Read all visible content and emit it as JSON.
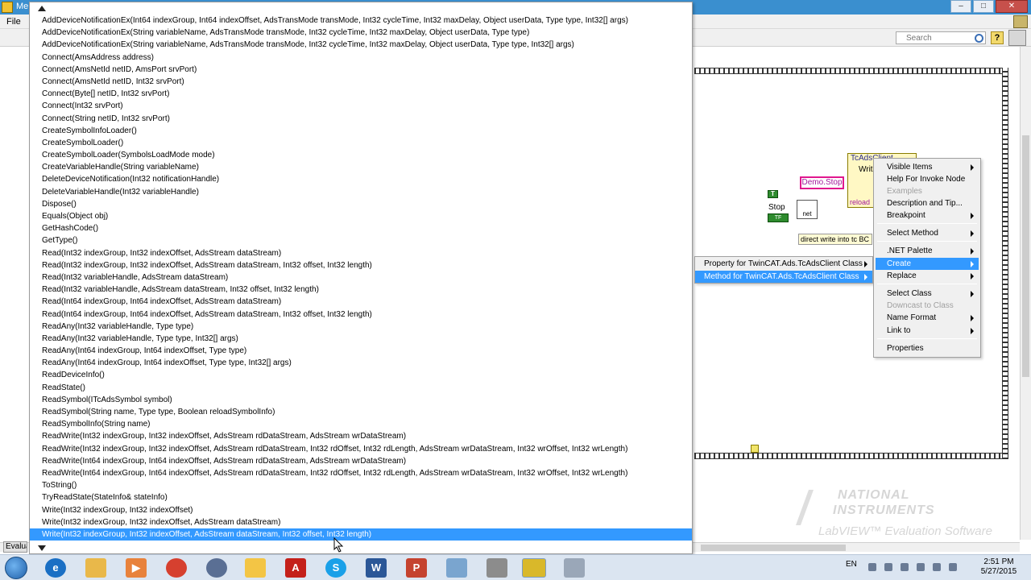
{
  "window": {
    "title_fragment": "Mel",
    "menu_file": "File",
    "search_placeholder": "Search",
    "eval_label": "Evaluat"
  },
  "methods": {
    "items": [
      "AddDeviceNotificationEx(Int64 indexGroup, Int64 indexOffset, AdsTransMode transMode, Int32 cycleTime, Int32 maxDelay, Object userData, Type type, Int32[] args)",
      "AddDeviceNotificationEx(String variableName, AdsTransMode transMode, Int32 cycleTime, Int32 maxDelay, Object userData, Type type)",
      "AddDeviceNotificationEx(String variableName, AdsTransMode transMode, Int32 cycleTime, Int32 maxDelay, Object userData, Type type, Int32[] args)",
      "Connect(AmsAddress address)",
      "Connect(AmsNetId netID, AmsPort srvPort)",
      "Connect(AmsNetId netID, Int32 srvPort)",
      "Connect(Byte[] netID, Int32 srvPort)",
      "Connect(Int32 srvPort)",
      "Connect(String netID, Int32 srvPort)",
      "CreateSymbolInfoLoader()",
      "CreateSymbolLoader()",
      "CreateSymbolLoader(SymbolsLoadMode mode)",
      "CreateVariableHandle(String variableName)",
      "DeleteDeviceNotification(Int32 notificationHandle)",
      "DeleteVariableHandle(Int32 variableHandle)",
      "Dispose()",
      "Equals(Object obj)",
      "GetHashCode()",
      "GetType()",
      "Read(Int32 indexGroup, Int32 indexOffset, AdsStream dataStream)",
      "Read(Int32 indexGroup, Int32 indexOffset, AdsStream dataStream, Int32 offset, Int32 length)",
      "Read(Int32 variableHandle, AdsStream dataStream)",
      "Read(Int32 variableHandle, AdsStream dataStream, Int32 offset, Int32 length)",
      "Read(Int64 indexGroup, Int64 indexOffset, AdsStream dataStream)",
      "Read(Int64 indexGroup, Int64 indexOffset, AdsStream dataStream, Int32 offset, Int32 length)",
      "ReadAny(Int32 variableHandle, Type type)",
      "ReadAny(Int32 variableHandle, Type type, Int32[] args)",
      "ReadAny(Int64 indexGroup, Int64 indexOffset, Type type)",
      "ReadAny(Int64 indexGroup, Int64 indexOffset, Type type, Int32[] args)",
      "ReadDeviceInfo()",
      "ReadState()",
      "ReadSymbol(ITcAdsSymbol symbol)",
      "ReadSymbol(String name, Type type, Boolean reloadSymbolInfo)",
      "ReadSymbolInfo(String name)",
      "ReadWrite(Int32 indexGroup, Int32 indexOffset, AdsStream rdDataStream, AdsStream wrDataStream)",
      "ReadWrite(Int32 indexGroup, Int32 indexOffset, AdsStream rdDataStream, Int32 rdOffset, Int32 rdLength, AdsStream wrDataStream, Int32 wrOffset, Int32 wrLength)",
      "ReadWrite(Int64 indexGroup, Int64 indexOffset, AdsStream rdDataStream, AdsStream wrDataStream)",
      "ReadWrite(Int64 indexGroup, Int64 indexOffset, AdsStream rdDataStream, Int32 rdOffset, Int32 rdLength, AdsStream wrDataStream, Int32 wrOffset, Int32 wrLength)",
      "ToString()",
      "TryReadState(StateInfo& stateInfo)",
      "Write(Int32 indexGroup, Int32 indexOffset)",
      "Write(Int32 indexGroup, Int32 indexOffset, AdsStream dataStream)",
      "Write(Int32 indexGroup, Int32 indexOffset, AdsStream dataStream, Int32 offset, Int32 length)"
    ],
    "selected_index": 42
  },
  "submenu": {
    "property": "Property for TwinCAT.Ads.TcAdsClient Class",
    "method": "Method for TwinCAT.Ads.TcAdsClient Class"
  },
  "context_menu": {
    "visible_items": "Visible Items",
    "help_invoke": "Help For Invoke Node",
    "examples": "Examples",
    "description": "Description and Tip...",
    "breakpoint": "Breakpoint",
    "select_method": "Select Method",
    "net_palette": ".NET Palette",
    "create": "Create",
    "replace": "Replace",
    "select_class": "Select Class",
    "downcast": "Downcast to Class",
    "name_format": "Name Format",
    "link_to": "Link to",
    "properties": "Properties"
  },
  "diagram": {
    "invoke_title": "TcAdsClient",
    "invoke_row": "Writ",
    "invoke_row2": "reload",
    "demo_stop": "Demo.Stop",
    "bool_const": "T",
    "stop_label": "Stop",
    "stop_terminal": "TF",
    "net_label": "net",
    "comment": "direct write into tc BC"
  },
  "watermark": {
    "line1": "NATIONAL",
    "line2": "INSTRUMENTS",
    "line3": "LabVIEW™ Evaluation Software"
  },
  "taskbar": {
    "lang": "EN",
    "time": "2:51 PM",
    "date": "5/27/2015"
  },
  "colors": {
    "selection": "#3399ff",
    "titlebar": "#3a8fcf",
    "demo_stop_border": "#e0188e",
    "taskbar": "#dbe5f1"
  }
}
